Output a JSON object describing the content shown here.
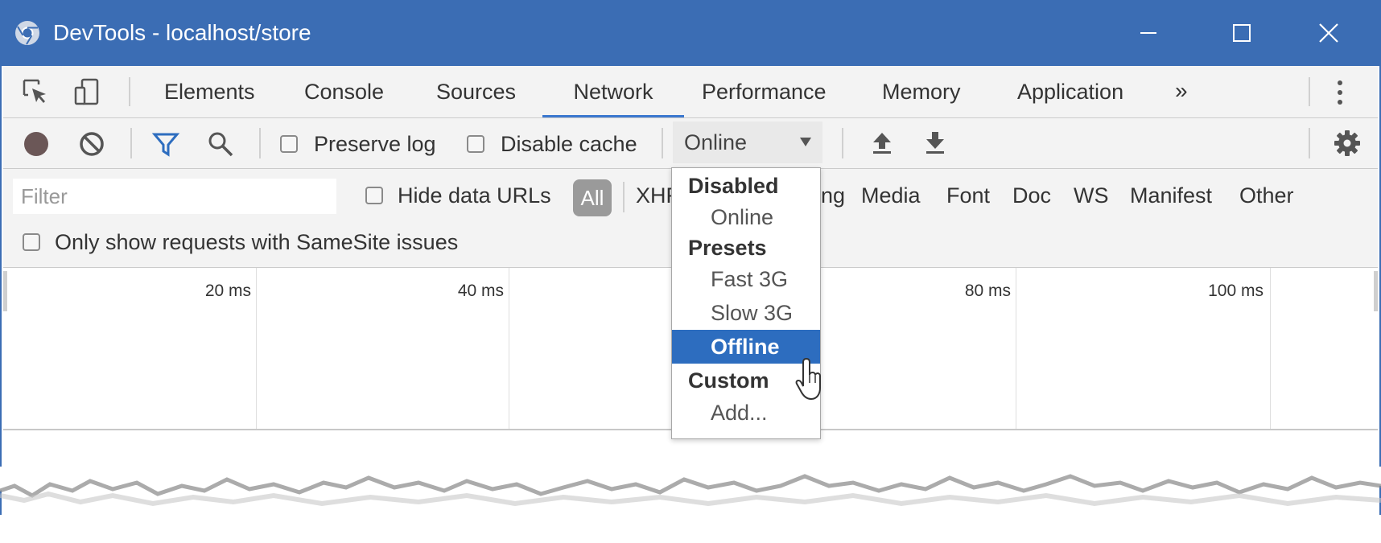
{
  "window": {
    "title": "DevTools - localhost/store",
    "accent_color": "#3b6db4",
    "controls": [
      "minimize-icon",
      "maximize-icon",
      "close-icon"
    ]
  },
  "tabs": {
    "items": [
      {
        "label": "Elements"
      },
      {
        "label": "Console"
      },
      {
        "label": "Sources"
      },
      {
        "label": "Network"
      },
      {
        "label": "Performance"
      },
      {
        "label": "Memory"
      },
      {
        "label": "Application"
      }
    ],
    "active": "Network",
    "more_label": "»"
  },
  "toolbar": {
    "preserve_log_label": "Preserve log",
    "disable_cache_label": "Disable cache",
    "throttle_value": "Online",
    "icons": [
      "record-icon",
      "clear-icon",
      "filter-icon",
      "search-icon",
      "upload-icon",
      "download-icon",
      "gear-icon"
    ]
  },
  "filter": {
    "placeholder": "Filter",
    "hide_data_urls_label": "Hide data URLs",
    "all_label": "All",
    "types_left": [
      "XHR"
    ],
    "types_right": [
      "Media",
      "Font",
      "Doc",
      "WS",
      "Manifest",
      "Other"
    ],
    "partial_type_fragment": "ng",
    "samesite_label": "Only show requests with SameSite issues"
  },
  "timeline": {
    "ticks": [
      "20 ms",
      "40 ms",
      "80 ms",
      "100 ms"
    ]
  },
  "throttle_dropdown": {
    "groups": [
      {
        "label": "Disabled",
        "items": [
          "Online"
        ]
      },
      {
        "label": "Presets",
        "items": [
          "Fast 3G",
          "Slow 3G",
          "Offline"
        ]
      },
      {
        "label": "Custom",
        "items": [
          "Add..."
        ]
      }
    ],
    "highlighted": "Offline",
    "highlight_color": "#2d6dbf"
  }
}
